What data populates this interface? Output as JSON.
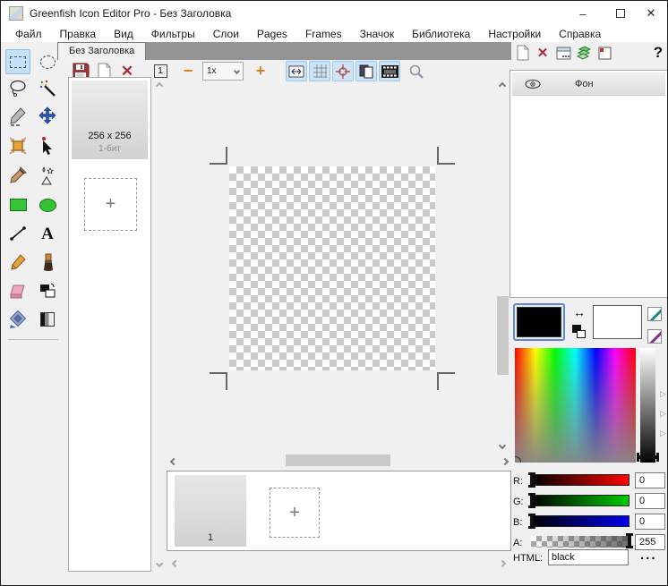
{
  "window": {
    "title": "Greenfish Icon Editor Pro - Без Заголовка",
    "minimize": "–",
    "close": "✕"
  },
  "menu": {
    "items": [
      {
        "label": "Файл"
      },
      {
        "label": "Правка"
      },
      {
        "label": "Вид"
      },
      {
        "label": "Фильтры"
      },
      {
        "label": "Слои"
      },
      {
        "label": "Pages"
      },
      {
        "label": "Frames"
      },
      {
        "label": "Значок"
      },
      {
        "label": "Библиотека"
      },
      {
        "label": "Настройки"
      },
      {
        "label": "Справка"
      }
    ]
  },
  "tabs": {
    "active": "Без Заголовка"
  },
  "toolbar": {
    "actual_size": "1",
    "zoom_out": "−",
    "zoom_level": "1x",
    "zoom_in": "+",
    "fit": "↔"
  },
  "right_toolbar": {
    "help": "?"
  },
  "layers": {
    "items": [
      {
        "name": "Фон"
      }
    ]
  },
  "pages": {
    "thumb": {
      "size": "256 x 256",
      "depth": "1-бит"
    },
    "add_label": "+"
  },
  "frames": {
    "items": [
      {
        "label": "1"
      }
    ],
    "add_label": "+"
  },
  "color": {
    "labels": {
      "r": "R:",
      "g": "G:",
      "b": "B:",
      "a": "A:",
      "html": "HTML:"
    },
    "values": {
      "r": "0",
      "g": "0",
      "b": "0",
      "a": "255",
      "html": "black"
    },
    "foreground": "#000000",
    "background": "#ffffff",
    "swap_glyph": "↔",
    "more": "...",
    "expander_glyph": "▷"
  }
}
